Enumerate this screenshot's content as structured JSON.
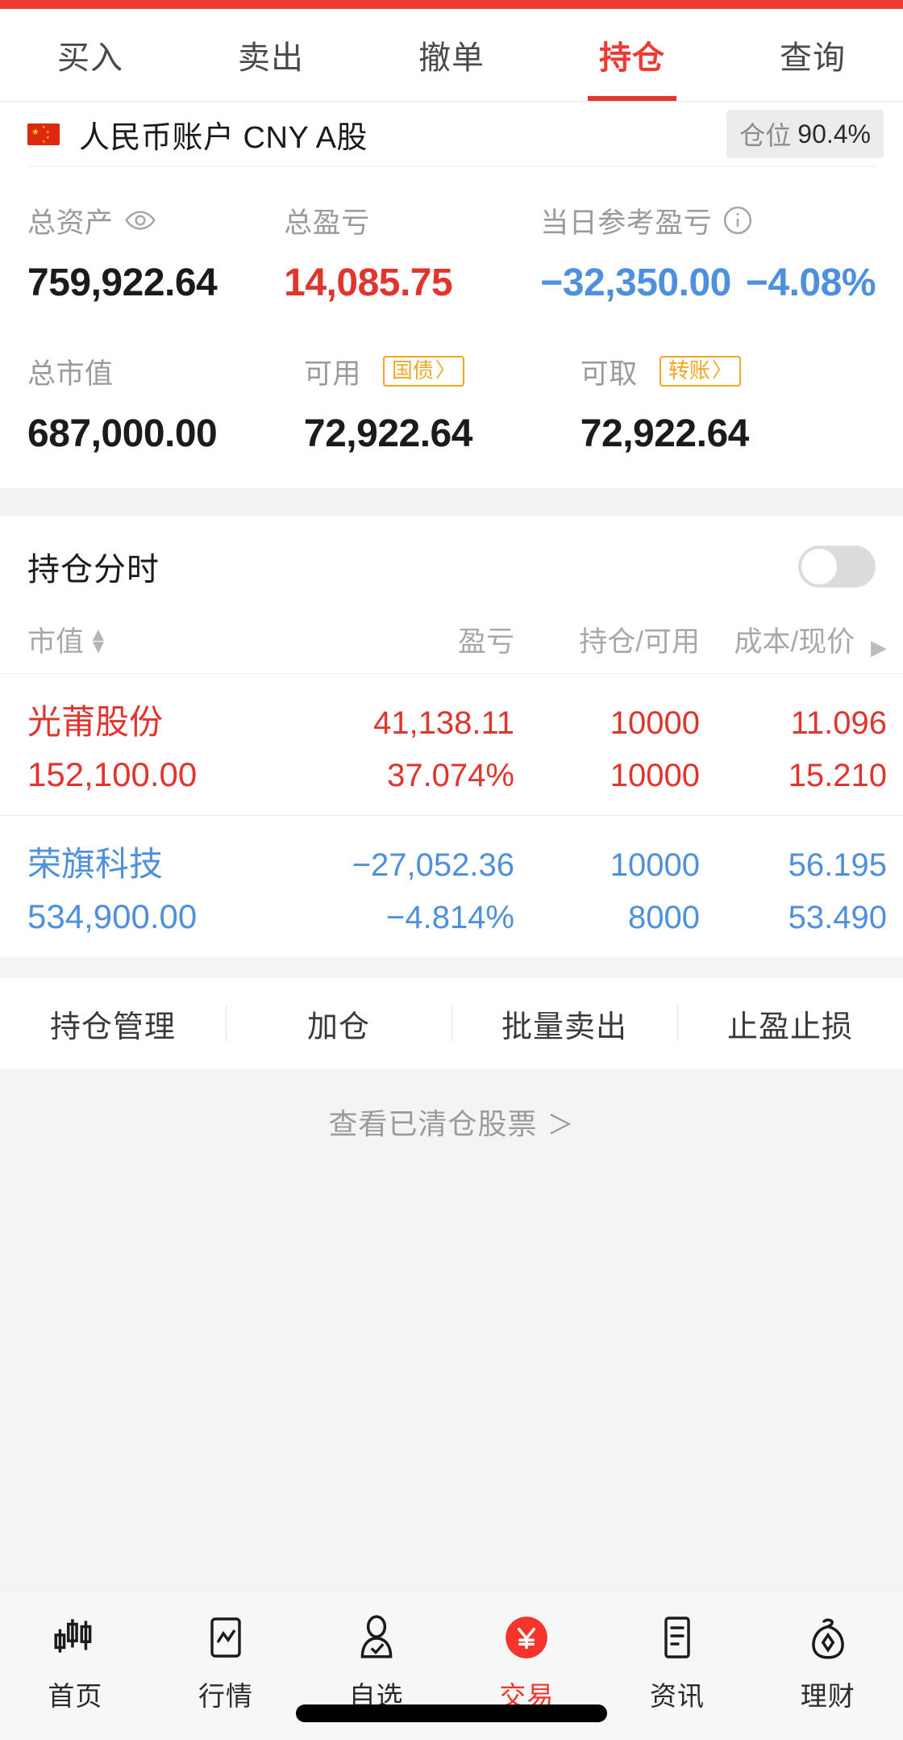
{
  "tabs": [
    {
      "label": "买入",
      "active": false
    },
    {
      "label": "卖出",
      "active": false
    },
    {
      "label": "撤单",
      "active": false
    },
    {
      "label": "持仓",
      "active": true
    },
    {
      "label": "查询",
      "active": false
    }
  ],
  "account": {
    "name": "人民币账户 CNY A股",
    "flag_icon": "china-flag-icon",
    "position_badge": {
      "label": "仓位",
      "value": "90.4%"
    }
  },
  "summary": {
    "row1": [
      {
        "label": "总资产",
        "icon": "eye-icon",
        "value": "759,922.64",
        "color": "dark"
      },
      {
        "label": "总盈亏",
        "icon": "",
        "value": "14,085.75",
        "color": "red"
      },
      {
        "label": "当日参考盈亏",
        "icon": "info-icon",
        "value": "−32,350.00",
        "sub": "−4.08%",
        "color": "blue"
      }
    ],
    "row2": [
      {
        "label": "总市值",
        "badge": "",
        "badge_caret": "",
        "value": "687,000.00",
        "color": "dark"
      },
      {
        "label": "可用",
        "badge": "国债",
        "badge_caret": "〉",
        "value": "72,922.64",
        "color": "dark"
      },
      {
        "label": "可取",
        "badge": "转账",
        "badge_caret": "〉",
        "value": "72,922.64",
        "color": "dark"
      }
    ]
  },
  "holdings": {
    "title": "持仓分时",
    "toggle_on": false,
    "columns": [
      "市值",
      "盈亏",
      "持仓/可用",
      "成本/现价"
    ],
    "sort_icon": "sort-arrows-icon",
    "expand_icon": "chevron-right-icon",
    "rows": [
      {
        "name": "光莆股份",
        "market_value": "152,100.00",
        "pnl": "41,138.11",
        "pnl_pct": "37.074%",
        "qty": "10000",
        "available": "10000",
        "cost": "11.096",
        "price": "15.210",
        "direction": "up"
      },
      {
        "name": "荣旗科技",
        "market_value": "534,900.00",
        "pnl": "−27,052.36",
        "pnl_pct": "−4.814%",
        "qty": "10000",
        "available": "8000",
        "cost": "56.195",
        "price": "53.490",
        "direction": "down"
      }
    ]
  },
  "actions": [
    "持仓管理",
    "加仓",
    "批量卖出",
    "止盈止损"
  ],
  "cleared_link": {
    "label": "查看已清仓股票",
    "arrow": "＞"
  },
  "bottom_nav": [
    {
      "label": "首页",
      "icon": "candlestick-icon",
      "active": false
    },
    {
      "label": "行情",
      "icon": "line-chart-icon",
      "active": false
    },
    {
      "label": "自选",
      "icon": "person-check-icon",
      "active": false
    },
    {
      "label": "交易",
      "icon": "yuan-circle-icon",
      "active": true
    },
    {
      "label": "资讯",
      "icon": "news-document-icon",
      "active": false
    },
    {
      "label": "理财",
      "icon": "money-bag-icon",
      "active": false
    }
  ],
  "colors": {
    "brand_red": "#ee3b33",
    "up_red": "#e0352d",
    "down_blue": "#4e90de",
    "accent_orange": "#f6a623",
    "page_bg": "#f2f2f2"
  }
}
